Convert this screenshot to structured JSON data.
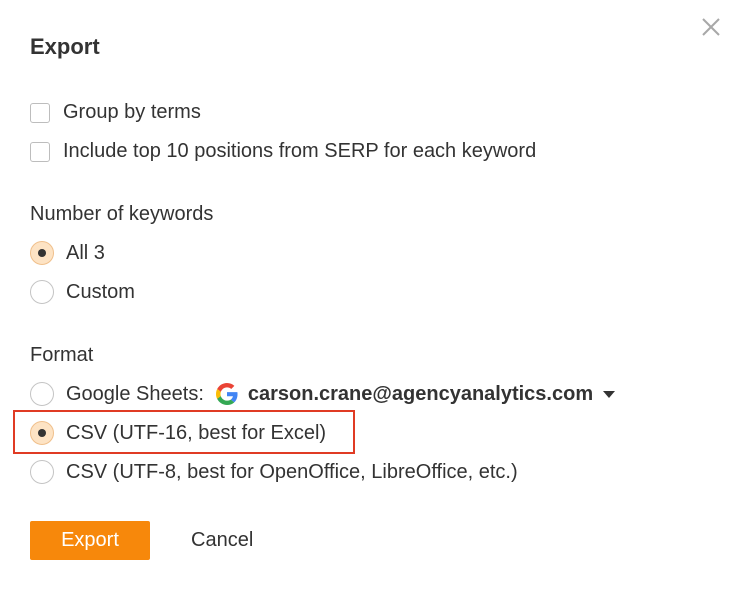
{
  "dialog": {
    "title": "Export",
    "close_icon": "close-icon"
  },
  "options": {
    "group_by_terms": {
      "label": "Group by terms",
      "checked": false
    },
    "include_top10": {
      "label": "Include top 10 positions from SERP for each keyword",
      "checked": false
    }
  },
  "keywords": {
    "label": "Number of keywords",
    "all": {
      "label": "All 3",
      "selected": true
    },
    "custom": {
      "label": "Custom",
      "selected": false
    }
  },
  "format": {
    "label": "Format",
    "google_sheets": {
      "label": "Google Sheets:",
      "icon": "google-icon",
      "account": "carson.crane@agencyanalytics.com",
      "selected": false
    },
    "csv_utf16": {
      "label": "CSV (UTF-16, best for Excel)",
      "selected": true
    },
    "csv_utf8": {
      "label": "CSV (UTF-8, best for OpenOffice, LibreOffice, etc.)",
      "selected": false
    }
  },
  "actions": {
    "export_label": "Export",
    "cancel_label": "Cancel"
  },
  "colors": {
    "accent": "#f7880b",
    "radio_selected_fill": "#fde3c4",
    "highlight_border": "#e03b24",
    "text": "#333333"
  }
}
